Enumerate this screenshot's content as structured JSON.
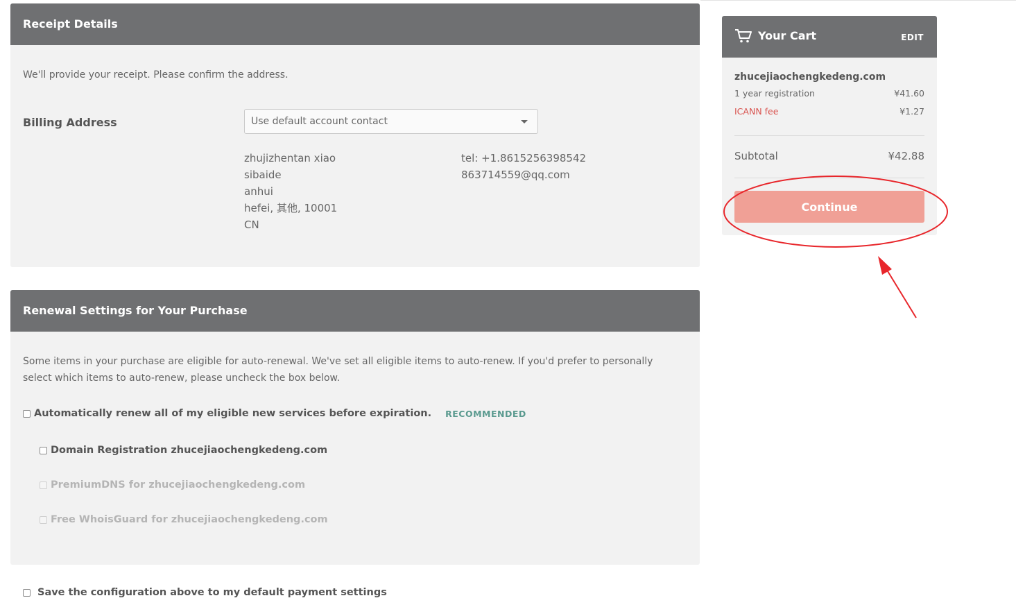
{
  "receipt": {
    "title": "Receipt Details",
    "intro": "We'll provide your receipt. Please confirm the address.",
    "billing_label": "Billing Address",
    "select_value": "Use default account contact",
    "address": {
      "name": "zhujizhentan xiao",
      "street": "sibaide",
      "state": "anhui",
      "city_line": "hefei, 其他, 10001",
      "country": "CN",
      "tel": "tel: +1.8615256398542",
      "email": "863714559@qq.com"
    }
  },
  "renewal": {
    "title": "Renewal Settings for Your Purchase",
    "intro_1": "Some items in your purchase are eligible for auto-renewal. We've set all eligible items to auto-renew. If you'd prefer to personally",
    "intro_2": "select which items to auto-renew, please uncheck the box below.",
    "auto_renew_label": "Automatically renew all of my eligible new services before expiration.",
    "recommended": "RECOMMENDED",
    "items": [
      {
        "label": "Domain Registration zhucejiaochengkedeng.com",
        "disabled": false
      },
      {
        "label": "PremiumDNS for zhucejiaochengkedeng.com",
        "disabled": true
      },
      {
        "label": "Free WhoisGuard for zhucejiaochengkedeng.com",
        "disabled": true
      }
    ]
  },
  "save_config_label": "Save the configuration above to my default payment settings",
  "cart": {
    "title": "Your Cart",
    "edit": "EDIT",
    "domain": "zhucejiaochengkedeng.com",
    "registration_label": "1 year registration",
    "registration_price": "¥41.60",
    "icann_label": "ICANN fee",
    "icann_price": "¥1.27",
    "subtotal_label": "Subtotal",
    "subtotal_value": "¥42.88",
    "continue_label": "Continue"
  },
  "colors": {
    "header_bg": "#6f7072",
    "panel_bg": "#f2f2f2",
    "continue_bg": "#f0a096",
    "annotation_red": "#e8262b",
    "recommended": "#5a9a8f"
  }
}
